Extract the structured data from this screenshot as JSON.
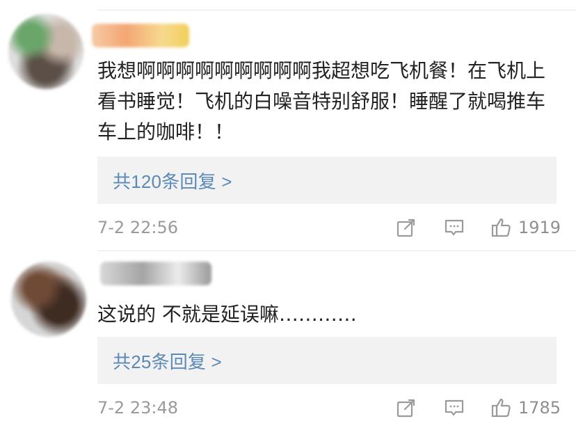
{
  "comments": [
    {
      "text": "我想啊啊啊啊啊啊啊啊啊我超想吃飞机餐！在飞机上看书睡觉！飞机的白噪音特别舒服！睡醒了就喝推车车上的咖啡！！",
      "reply_label": "共120条回复 >",
      "timestamp": "7-2 22:56",
      "likes": "1919",
      "icons": {
        "share": "share-icon",
        "comment": "comment-icon",
        "like": "thumbs-up-icon"
      }
    },
    {
      "text": "这说的 不就是延误嘛…………",
      "reply_label": "共25条回复 >",
      "timestamp": "7-2 23:48",
      "likes": "1785",
      "icons": {
        "share": "share-icon",
        "comment": "comment-icon",
        "like": "thumbs-up-icon"
      }
    }
  ],
  "colors": {
    "reply_link": "#5b8ab7",
    "meta_text": "#9a9a9a",
    "reply_background": "#f2f2f2",
    "divider": "#e6e6e6"
  }
}
